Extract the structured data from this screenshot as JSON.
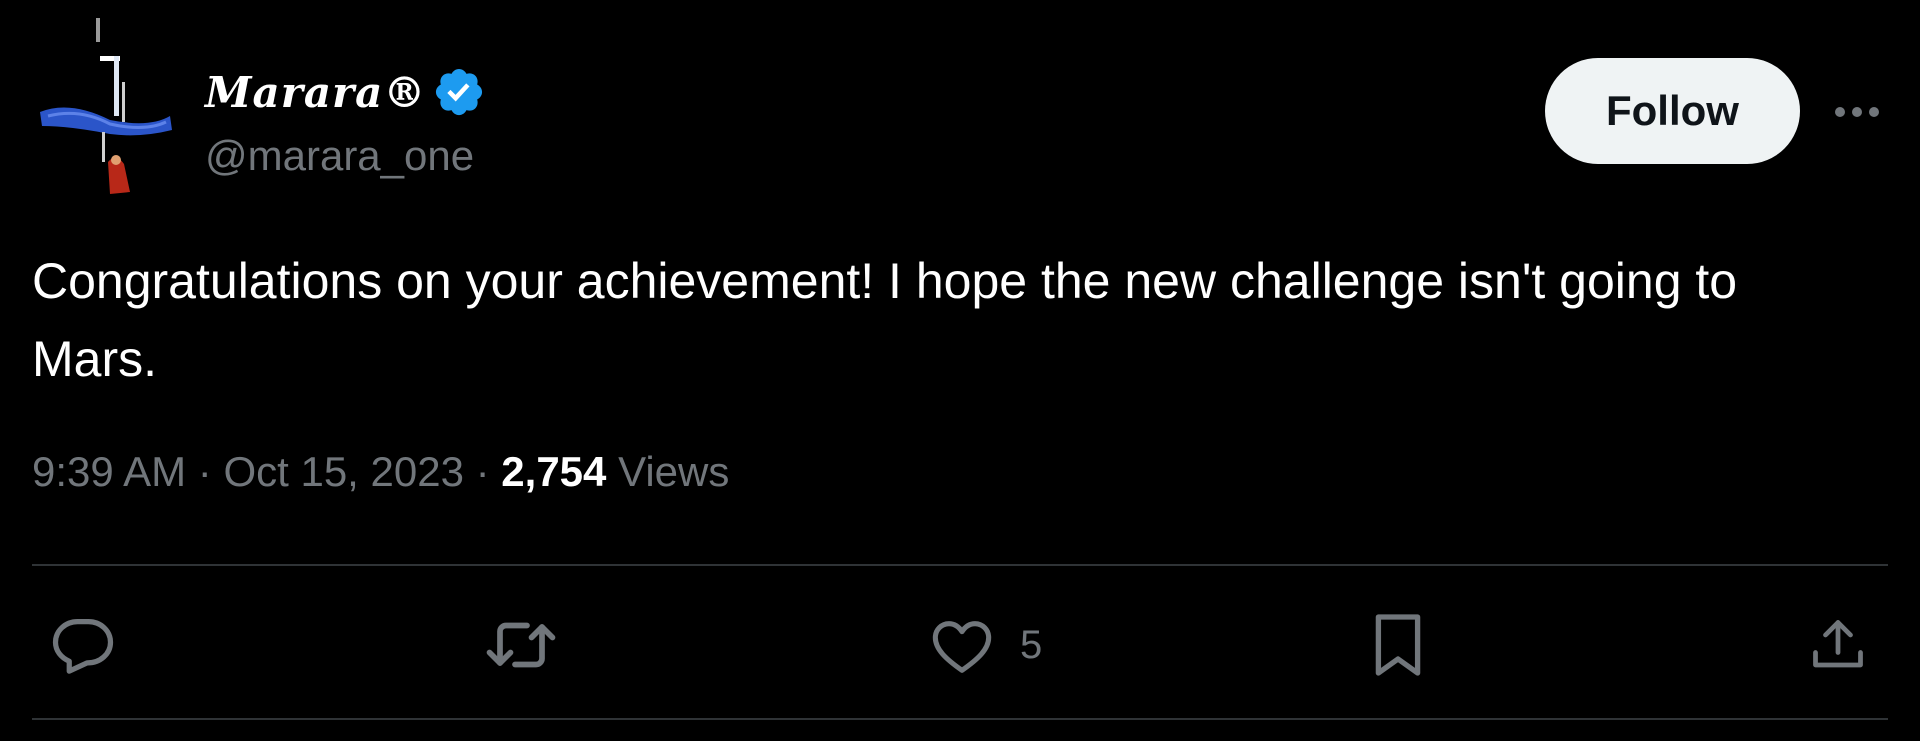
{
  "user": {
    "display_name": "Marara®",
    "handle": "@marara_one",
    "verified_color": "#1d9bf0"
  },
  "follow_label": "Follow",
  "tweet": {
    "text": "Congratulations on your achievement! I hope the new challenge isn't going to Mars.",
    "time": "9:39 AM",
    "date": "Oct 15, 2023",
    "separator": "·",
    "views_count": "2,754",
    "views_label": "Views"
  },
  "actions": {
    "reply_icon": "reply-icon",
    "retweet_icon": "retweet-icon",
    "like_icon": "heart-icon",
    "like_count": "5",
    "bookmark_icon": "bookmark-icon",
    "share_icon": "share-icon"
  },
  "colors": {
    "background": "#000000",
    "text": "#ffffff",
    "muted": "#71767b",
    "divider": "#2f3336",
    "follow_bg": "#eff3f4"
  }
}
